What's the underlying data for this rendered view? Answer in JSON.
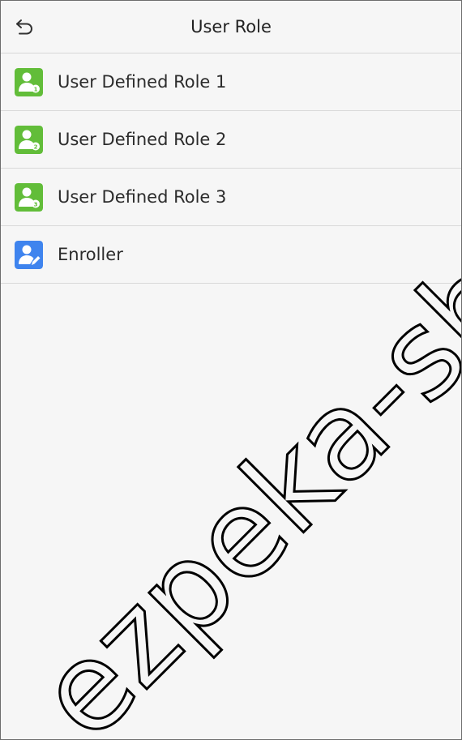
{
  "header": {
    "title": "User Role",
    "back_icon": "back-arrow-icon"
  },
  "roles": [
    {
      "label": "User Defined Role 1",
      "icon": "user-role-1-icon",
      "color": "#62bd39"
    },
    {
      "label": "User Defined Role 2",
      "icon": "user-role-2-icon",
      "color": "#62bd39"
    },
    {
      "label": "User Defined Role 3",
      "icon": "user-role-3-icon",
      "color": "#62bd39"
    },
    {
      "label": "Enroller",
      "icon": "enroller-icon",
      "color": "#3f84ee"
    }
  ],
  "watermark": "ezpeka-sho",
  "colors": {
    "background": "#f6f6f6",
    "divider": "#d9d9d9",
    "role_green": "#62bd39",
    "enroller_blue": "#3f84ee"
  }
}
